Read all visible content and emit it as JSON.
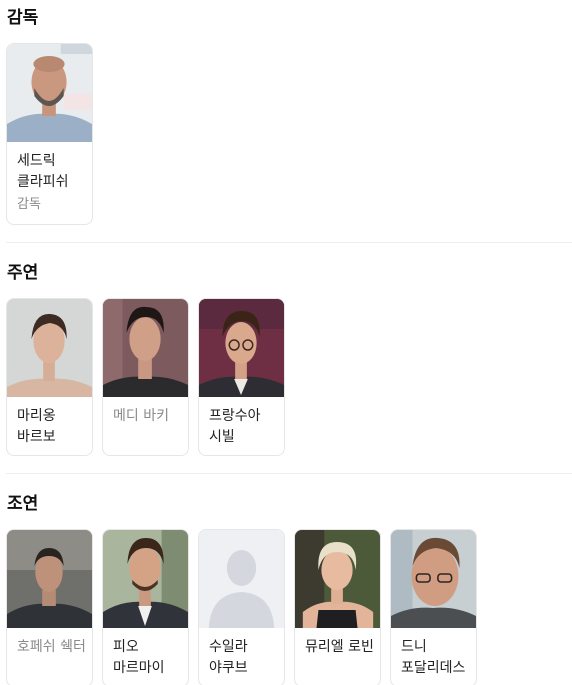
{
  "sections": [
    {
      "title": "감독",
      "people": [
        {
          "name": "세드릭 클라피쉬",
          "role": "감독",
          "muted": false
        }
      ]
    },
    {
      "title": "주연",
      "people": [
        {
          "name": "마리옹 바르보",
          "muted": false
        },
        {
          "name": "메디 바키",
          "muted": true
        },
        {
          "name": "프랑수아 시빌",
          "muted": false
        }
      ]
    },
    {
      "title": "조연",
      "people": [
        {
          "name": "호페쉬 쉑터",
          "muted": true
        },
        {
          "name": "피오 마르마이",
          "muted": false
        },
        {
          "name": "수일라 야쿠브",
          "muted": false
        },
        {
          "name": "뮤리엘 로빈",
          "muted": false
        },
        {
          "name": "드니 포달리데스",
          "muted": false
        }
      ]
    }
  ]
}
